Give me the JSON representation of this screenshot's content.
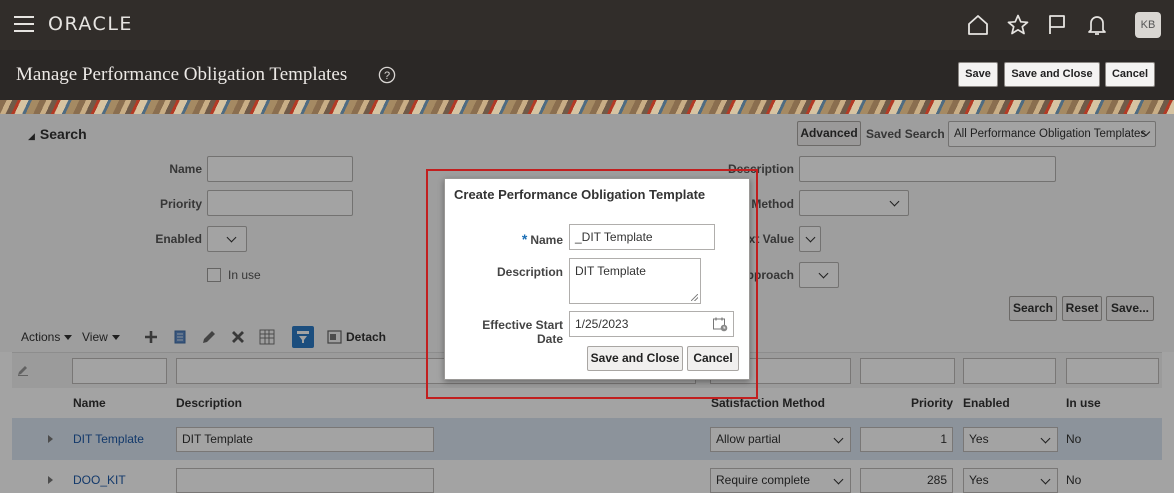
{
  "app": {
    "logo": "ORACLE",
    "user_initials": "KB",
    "page_title": "Manage Performance Obligation Templates"
  },
  "header_actions": {
    "save": "Save",
    "save_close": "Save and Close",
    "cancel": "Cancel"
  },
  "search": {
    "title": "Search",
    "advanced": "Advanced",
    "saved_search_label": "Saved Search",
    "saved_search_value": "All Performance Obligation Templates",
    "fields": {
      "name": "Name",
      "priority": "Priority",
      "enabled": "Enabled",
      "in_use": "In use",
      "description": "Description",
      "method": "Method",
      "xt_value": "xt Value",
      "pproach": "pproach"
    },
    "buttons": {
      "search": "Search",
      "reset": "Reset",
      "save": "Save..."
    }
  },
  "toolbar": {
    "actions": "Actions",
    "view": "View",
    "detach": "Detach"
  },
  "table": {
    "columns": {
      "name": "Name",
      "description": "Description",
      "satisfaction_method": "Satisfaction Method",
      "priority": "Priority",
      "enabled": "Enabled",
      "in_use": "In use"
    },
    "rows": [
      {
        "name": "DIT Template",
        "description": "DIT Template",
        "satisfaction_method": "Allow partial",
        "priority": "1",
        "enabled": "Yes",
        "in_use": "No"
      },
      {
        "name": "DOO_KIT",
        "description": "",
        "satisfaction_method": "Require complete",
        "priority": "285",
        "enabled": "Yes",
        "in_use": "No"
      }
    ]
  },
  "dialog": {
    "title": "Create Performance Obligation Template",
    "required_marker": "*",
    "name_label": "Name",
    "name_value": "_DIT Template",
    "description_label": "Description",
    "description_value": "DIT Template",
    "start_date_label": "Effective Start Date",
    "start_date_value": "1/25/2023",
    "save_close": "Save and Close",
    "cancel": "Cancel"
  },
  "colors": {
    "header_bg": "#312d2a",
    "highlight_border": "#c21f1f",
    "link": "#1e5aa8",
    "selected_row": "#dbe7f2"
  }
}
